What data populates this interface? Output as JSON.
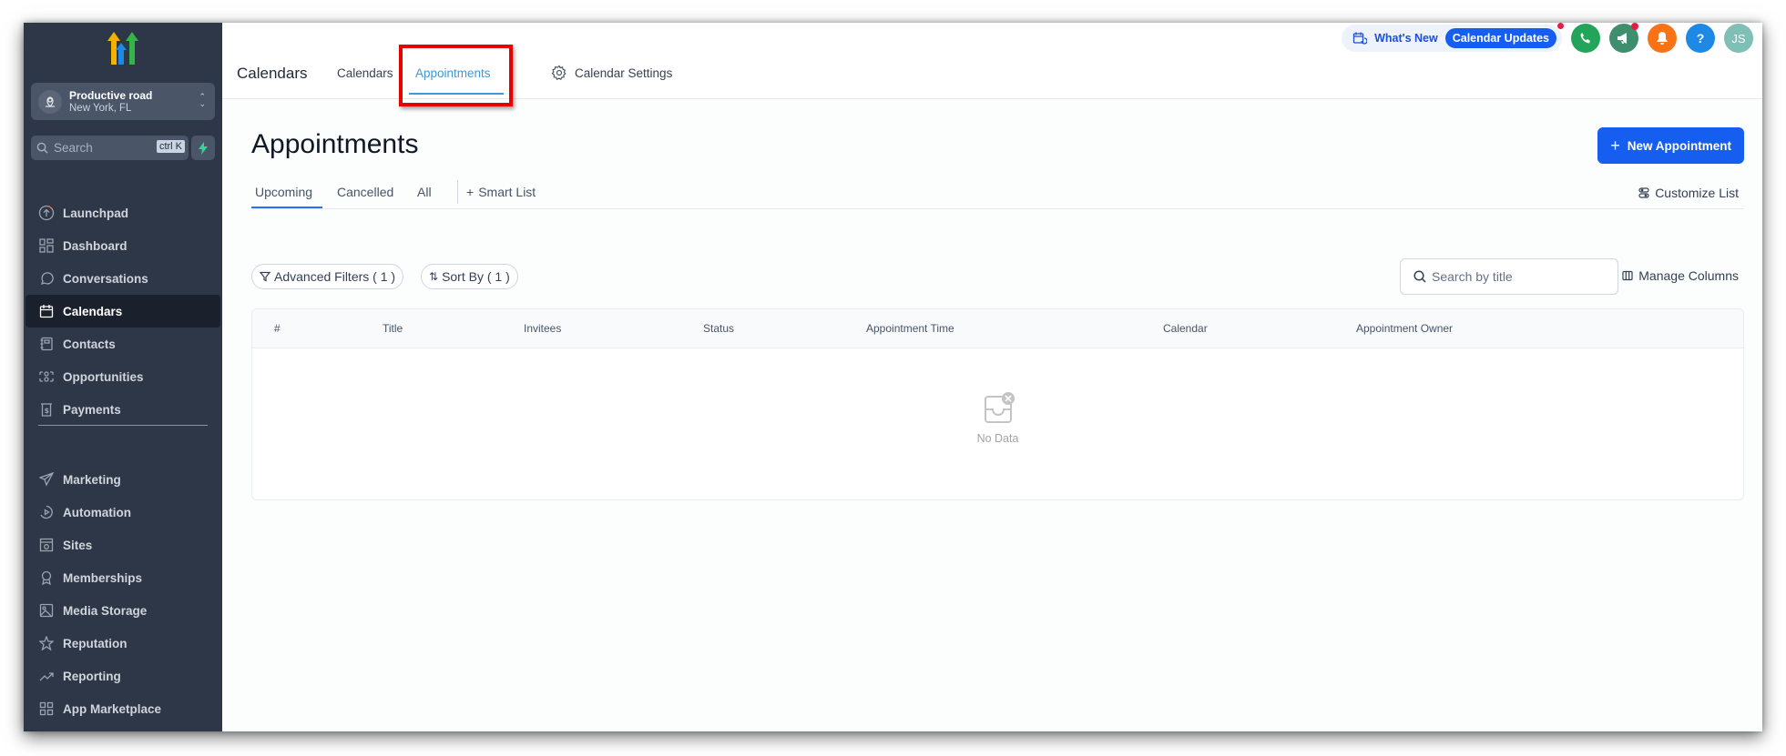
{
  "sidebar": {
    "account": {
      "name": "Productive road",
      "location": "New York, FL"
    },
    "search": {
      "placeholder": "Search",
      "shortcut": "ctrl K"
    },
    "items_primary": [
      {
        "label": "Launchpad",
        "icon": "launchpad-icon"
      },
      {
        "label": "Dashboard",
        "icon": "dashboard-icon"
      },
      {
        "label": "Conversations",
        "icon": "chat-icon"
      },
      {
        "label": "Calendars",
        "icon": "calendar-icon",
        "active": true
      },
      {
        "label": "Contacts",
        "icon": "contacts-icon"
      },
      {
        "label": "Opportunities",
        "icon": "opportunities-icon"
      },
      {
        "label": "Payments",
        "icon": "payments-icon"
      }
    ],
    "items_secondary": [
      {
        "label": "Marketing",
        "icon": "send-icon"
      },
      {
        "label": "Automation",
        "icon": "automation-icon"
      },
      {
        "label": "Sites",
        "icon": "sites-icon"
      },
      {
        "label": "Memberships",
        "icon": "award-icon"
      },
      {
        "label": "Media Storage",
        "icon": "image-icon"
      },
      {
        "label": "Reputation",
        "icon": "star-icon"
      },
      {
        "label": "Reporting",
        "icon": "trending-icon"
      },
      {
        "label": "App Marketplace",
        "icon": "apps-icon"
      }
    ]
  },
  "header": {
    "page_label": "Calendars",
    "tabs": [
      {
        "label": "Calendars"
      },
      {
        "label": "Appointments",
        "active": true
      },
      {
        "label": "Calendar Settings"
      }
    ],
    "whats_new": "What's New",
    "calendar_updates": "Calendar Updates",
    "avatar_initials": "JS",
    "help_glyph": "?",
    "colors": {
      "phone": "#22a55a",
      "megaphone": "#3f8f6f",
      "bell": "#f97316",
      "help": "#1e88e5",
      "avatar": "#7fbfb5",
      "accent": "#155eef"
    }
  },
  "main": {
    "title": "Appointments",
    "new_button": "New Appointment",
    "subtabs": [
      {
        "label": "Upcoming",
        "active": true
      },
      {
        "label": "Cancelled"
      },
      {
        "label": "All"
      }
    ],
    "smart_list": "Smart List",
    "customize_list": "Customize List",
    "advanced_filters": "Advanced Filters ( 1 )",
    "sort_by": "Sort By ( 1 )",
    "search_placeholder": "Search by title",
    "manage_columns": "Manage Columns",
    "table": {
      "columns": [
        "#",
        "Title",
        "Invitees",
        "Status",
        "Appointment Time",
        "Calendar",
        "Appointment Owner"
      ],
      "rows": [],
      "empty_text": "No Data"
    }
  }
}
